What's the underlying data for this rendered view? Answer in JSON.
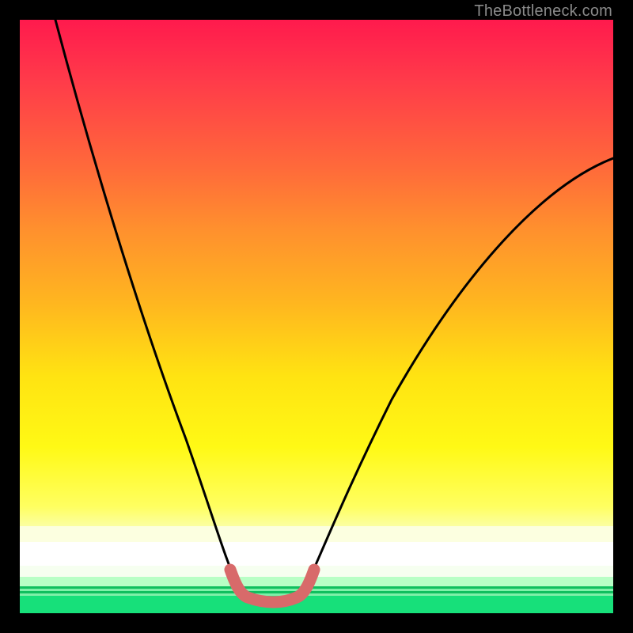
{
  "watermark": "TheBottleneck.com",
  "chart_data": {
    "type": "line",
    "title": "",
    "xlabel": "",
    "ylabel": "",
    "xlim": [
      0,
      100
    ],
    "ylim": [
      0,
      100
    ],
    "grid": false,
    "legend": false,
    "series": [
      {
        "name": "bottleneck-curve",
        "x": [
          6,
          10,
          15,
          20,
          25,
          30,
          33,
          36,
          38,
          40,
          44,
          48,
          50,
          55,
          60,
          70,
          80,
          90,
          100
        ],
        "y": [
          100,
          85,
          70,
          55,
          40,
          25,
          13,
          5,
          2,
          2,
          2,
          5,
          9,
          18,
          28,
          45,
          57,
          65,
          70
        ]
      }
    ],
    "annotations": [
      {
        "name": "optimal-zone-marker",
        "x_range": [
          36,
          48
        ],
        "y": 2,
        "color": "#d86a6a"
      }
    ],
    "background_gradient": {
      "stops": [
        {
          "pos": 0,
          "color": "#ff1a4d"
        },
        {
          "pos": 50,
          "color": "#ffb71f"
        },
        {
          "pos": 75,
          "color": "#ffff40"
        },
        {
          "pos": 90,
          "color": "#ffffff"
        },
        {
          "pos": 100,
          "color": "#17e07a"
        }
      ]
    }
  }
}
